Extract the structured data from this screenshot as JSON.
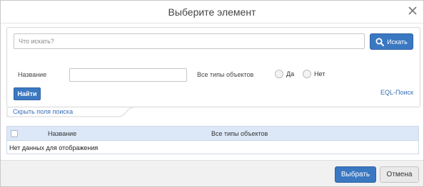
{
  "dialog": {
    "title": "Выберите элемент"
  },
  "search": {
    "placeholder": "Что искать?",
    "button_label": "Искать"
  },
  "filters": {
    "name_label": "Название",
    "name_value": "",
    "types_label": "Все типы объектов",
    "option_yes": "Да",
    "option_no": "Нет",
    "find_button": "Найти",
    "eql_link": "EQL-Поиск"
  },
  "hide_fields_link": "Скрыть поля поиска",
  "grid": {
    "columns": [
      "Название",
      "Все типы объектов"
    ],
    "empty_message": "Нет данных для отображения"
  },
  "footer": {
    "select_button": "Выбрать",
    "cancel_button": "Отмена"
  },
  "colors": {
    "primary": "#3b78c2",
    "link": "#3a6eb5",
    "grid_header": "#dce8f7"
  }
}
